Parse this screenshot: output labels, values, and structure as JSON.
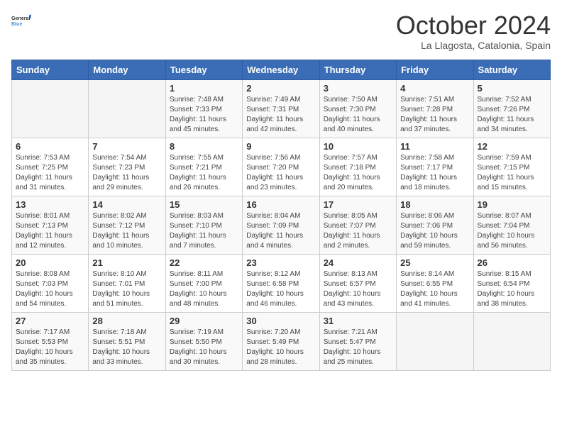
{
  "logo": {
    "line1": "General",
    "line2": "Blue"
  },
  "title": "October 2024",
  "subtitle": "La Llagosta, Catalonia, Spain",
  "weekdays": [
    "Sunday",
    "Monday",
    "Tuesday",
    "Wednesday",
    "Thursday",
    "Friday",
    "Saturday"
  ],
  "weeks": [
    [
      {
        "day": "",
        "sunrise": "",
        "sunset": "",
        "daylight": ""
      },
      {
        "day": "",
        "sunrise": "",
        "sunset": "",
        "daylight": ""
      },
      {
        "day": "1",
        "sunrise": "Sunrise: 7:48 AM",
        "sunset": "Sunset: 7:33 PM",
        "daylight": "Daylight: 11 hours and 45 minutes."
      },
      {
        "day": "2",
        "sunrise": "Sunrise: 7:49 AM",
        "sunset": "Sunset: 7:31 PM",
        "daylight": "Daylight: 11 hours and 42 minutes."
      },
      {
        "day": "3",
        "sunrise": "Sunrise: 7:50 AM",
        "sunset": "Sunset: 7:30 PM",
        "daylight": "Daylight: 11 hours and 40 minutes."
      },
      {
        "day": "4",
        "sunrise": "Sunrise: 7:51 AM",
        "sunset": "Sunset: 7:28 PM",
        "daylight": "Daylight: 11 hours and 37 minutes."
      },
      {
        "day": "5",
        "sunrise": "Sunrise: 7:52 AM",
        "sunset": "Sunset: 7:26 PM",
        "daylight": "Daylight: 11 hours and 34 minutes."
      }
    ],
    [
      {
        "day": "6",
        "sunrise": "Sunrise: 7:53 AM",
        "sunset": "Sunset: 7:25 PM",
        "daylight": "Daylight: 11 hours and 31 minutes."
      },
      {
        "day": "7",
        "sunrise": "Sunrise: 7:54 AM",
        "sunset": "Sunset: 7:23 PM",
        "daylight": "Daylight: 11 hours and 29 minutes."
      },
      {
        "day": "8",
        "sunrise": "Sunrise: 7:55 AM",
        "sunset": "Sunset: 7:21 PM",
        "daylight": "Daylight: 11 hours and 26 minutes."
      },
      {
        "day": "9",
        "sunrise": "Sunrise: 7:56 AM",
        "sunset": "Sunset: 7:20 PM",
        "daylight": "Daylight: 11 hours and 23 minutes."
      },
      {
        "day": "10",
        "sunrise": "Sunrise: 7:57 AM",
        "sunset": "Sunset: 7:18 PM",
        "daylight": "Daylight: 11 hours and 20 minutes."
      },
      {
        "day": "11",
        "sunrise": "Sunrise: 7:58 AM",
        "sunset": "Sunset: 7:17 PM",
        "daylight": "Daylight: 11 hours and 18 minutes."
      },
      {
        "day": "12",
        "sunrise": "Sunrise: 7:59 AM",
        "sunset": "Sunset: 7:15 PM",
        "daylight": "Daylight: 11 hours and 15 minutes."
      }
    ],
    [
      {
        "day": "13",
        "sunrise": "Sunrise: 8:01 AM",
        "sunset": "Sunset: 7:13 PM",
        "daylight": "Daylight: 11 hours and 12 minutes."
      },
      {
        "day": "14",
        "sunrise": "Sunrise: 8:02 AM",
        "sunset": "Sunset: 7:12 PM",
        "daylight": "Daylight: 11 hours and 10 minutes."
      },
      {
        "day": "15",
        "sunrise": "Sunrise: 8:03 AM",
        "sunset": "Sunset: 7:10 PM",
        "daylight": "Daylight: 11 hours and 7 minutes."
      },
      {
        "day": "16",
        "sunrise": "Sunrise: 8:04 AM",
        "sunset": "Sunset: 7:09 PM",
        "daylight": "Daylight: 11 hours and 4 minutes."
      },
      {
        "day": "17",
        "sunrise": "Sunrise: 8:05 AM",
        "sunset": "Sunset: 7:07 PM",
        "daylight": "Daylight: 11 hours and 2 minutes."
      },
      {
        "day": "18",
        "sunrise": "Sunrise: 8:06 AM",
        "sunset": "Sunset: 7:06 PM",
        "daylight": "Daylight: 10 hours and 59 minutes."
      },
      {
        "day": "19",
        "sunrise": "Sunrise: 8:07 AM",
        "sunset": "Sunset: 7:04 PM",
        "daylight": "Daylight: 10 hours and 56 minutes."
      }
    ],
    [
      {
        "day": "20",
        "sunrise": "Sunrise: 8:08 AM",
        "sunset": "Sunset: 7:03 PM",
        "daylight": "Daylight: 10 hours and 54 minutes."
      },
      {
        "day": "21",
        "sunrise": "Sunrise: 8:10 AM",
        "sunset": "Sunset: 7:01 PM",
        "daylight": "Daylight: 10 hours and 51 minutes."
      },
      {
        "day": "22",
        "sunrise": "Sunrise: 8:11 AM",
        "sunset": "Sunset: 7:00 PM",
        "daylight": "Daylight: 10 hours and 48 minutes."
      },
      {
        "day": "23",
        "sunrise": "Sunrise: 8:12 AM",
        "sunset": "Sunset: 6:58 PM",
        "daylight": "Daylight: 10 hours and 46 minutes."
      },
      {
        "day": "24",
        "sunrise": "Sunrise: 8:13 AM",
        "sunset": "Sunset: 6:57 PM",
        "daylight": "Daylight: 10 hours and 43 minutes."
      },
      {
        "day": "25",
        "sunrise": "Sunrise: 8:14 AM",
        "sunset": "Sunset: 6:55 PM",
        "daylight": "Daylight: 10 hours and 41 minutes."
      },
      {
        "day": "26",
        "sunrise": "Sunrise: 8:15 AM",
        "sunset": "Sunset: 6:54 PM",
        "daylight": "Daylight: 10 hours and 38 minutes."
      }
    ],
    [
      {
        "day": "27",
        "sunrise": "Sunrise: 7:17 AM",
        "sunset": "Sunset: 5:53 PM",
        "daylight": "Daylight: 10 hours and 35 minutes."
      },
      {
        "day": "28",
        "sunrise": "Sunrise: 7:18 AM",
        "sunset": "Sunset: 5:51 PM",
        "daylight": "Daylight: 10 hours and 33 minutes."
      },
      {
        "day": "29",
        "sunrise": "Sunrise: 7:19 AM",
        "sunset": "Sunset: 5:50 PM",
        "daylight": "Daylight: 10 hours and 30 minutes."
      },
      {
        "day": "30",
        "sunrise": "Sunrise: 7:20 AM",
        "sunset": "Sunset: 5:49 PM",
        "daylight": "Daylight: 10 hours and 28 minutes."
      },
      {
        "day": "31",
        "sunrise": "Sunrise: 7:21 AM",
        "sunset": "Sunset: 5:47 PM",
        "daylight": "Daylight: 10 hours and 25 minutes."
      },
      {
        "day": "",
        "sunrise": "",
        "sunset": "",
        "daylight": ""
      },
      {
        "day": "",
        "sunrise": "",
        "sunset": "",
        "daylight": ""
      }
    ]
  ]
}
